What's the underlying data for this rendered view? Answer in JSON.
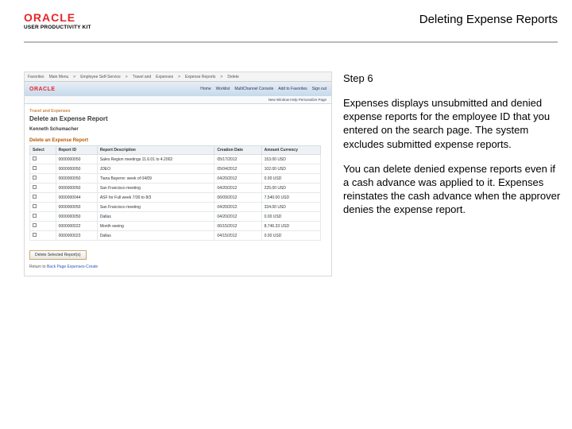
{
  "header": {
    "brand_name": "ORACLE",
    "product_line": "USER PRODUCTIVITY KIT",
    "page_title": "Deleting Expense Reports"
  },
  "instructions": {
    "step_label": "Step 6",
    "para1": "Expenses displays unsubmitted and denied expense reports for the employee ID that you entered on the search page. The system excludes submitted expense reports.",
    "para2": "You can delete denied expense reports even if a cash advance was applied to it. Expenses reinstates the cash advance when the approver denies the expense report."
  },
  "app": {
    "topmenu": [
      "Favorites",
      "Main Menu",
      "Employee Self-Service",
      "Travel and",
      "Expenses",
      "Expense Reports",
      "Delete"
    ],
    "brand": "ORACLE",
    "tabs": [
      "Home",
      "Worklist",
      "MultiChannel Console",
      "Add to Favorites",
      "Sign out"
    ],
    "subbar": "New Window   Help   Personalize Page",
    "crumb": "Travel and Expenses",
    "title": "Delete an Expense Report",
    "subtitle": "Kenneth Schumacher",
    "section": "Delete an Expense Report",
    "columns": [
      "Select",
      "Report ID",
      "Report Description",
      "Creation Date",
      "Amount Currency"
    ],
    "rows": [
      {
        "id": "0000000050",
        "desc": "Sales Region meetings 11.6.01 to 4.2002",
        "date": "05/17/2012",
        "amt": "153.00 USD"
      },
      {
        "id": "0000000050",
        "desc": "JDEO",
        "date": "05/04/2012",
        "amt": "102.00 USD"
      },
      {
        "id": "0000000050",
        "desc": "Tiana Bayerre: week of 04/09",
        "date": "04/20/2012",
        "amt": "0.00 USD"
      },
      {
        "id": "0000000050",
        "desc": "San Francisco meeting",
        "date": "04/20/2012",
        "amt": "225.00 USD"
      },
      {
        "id": "0000000044",
        "desc": "ASF for Full week 7/30 to 8/3",
        "date": "06/09/2012",
        "amt": "7,540.00 USD"
      },
      {
        "id": "0000000050",
        "desc": "San Francisco meeting",
        "date": "04/20/2012",
        "amt": "334.00 USD"
      },
      {
        "id": "0000000050",
        "desc": "Dallas",
        "date": "04/20/2012",
        "amt": "0.00 USD"
      },
      {
        "id": "0000000022",
        "desc": "Month seeing",
        "date": "06/15/2012",
        "amt": "8,746.33 USD"
      },
      {
        "id": "0000000023",
        "desc": "Dallas",
        "date": "04/15/2012",
        "amt": "0.00 USD"
      }
    ],
    "button": "Delete Selected Report(s)",
    "footer_label": "Return to",
    "footer_link": "Back Page Expenses-Create"
  }
}
